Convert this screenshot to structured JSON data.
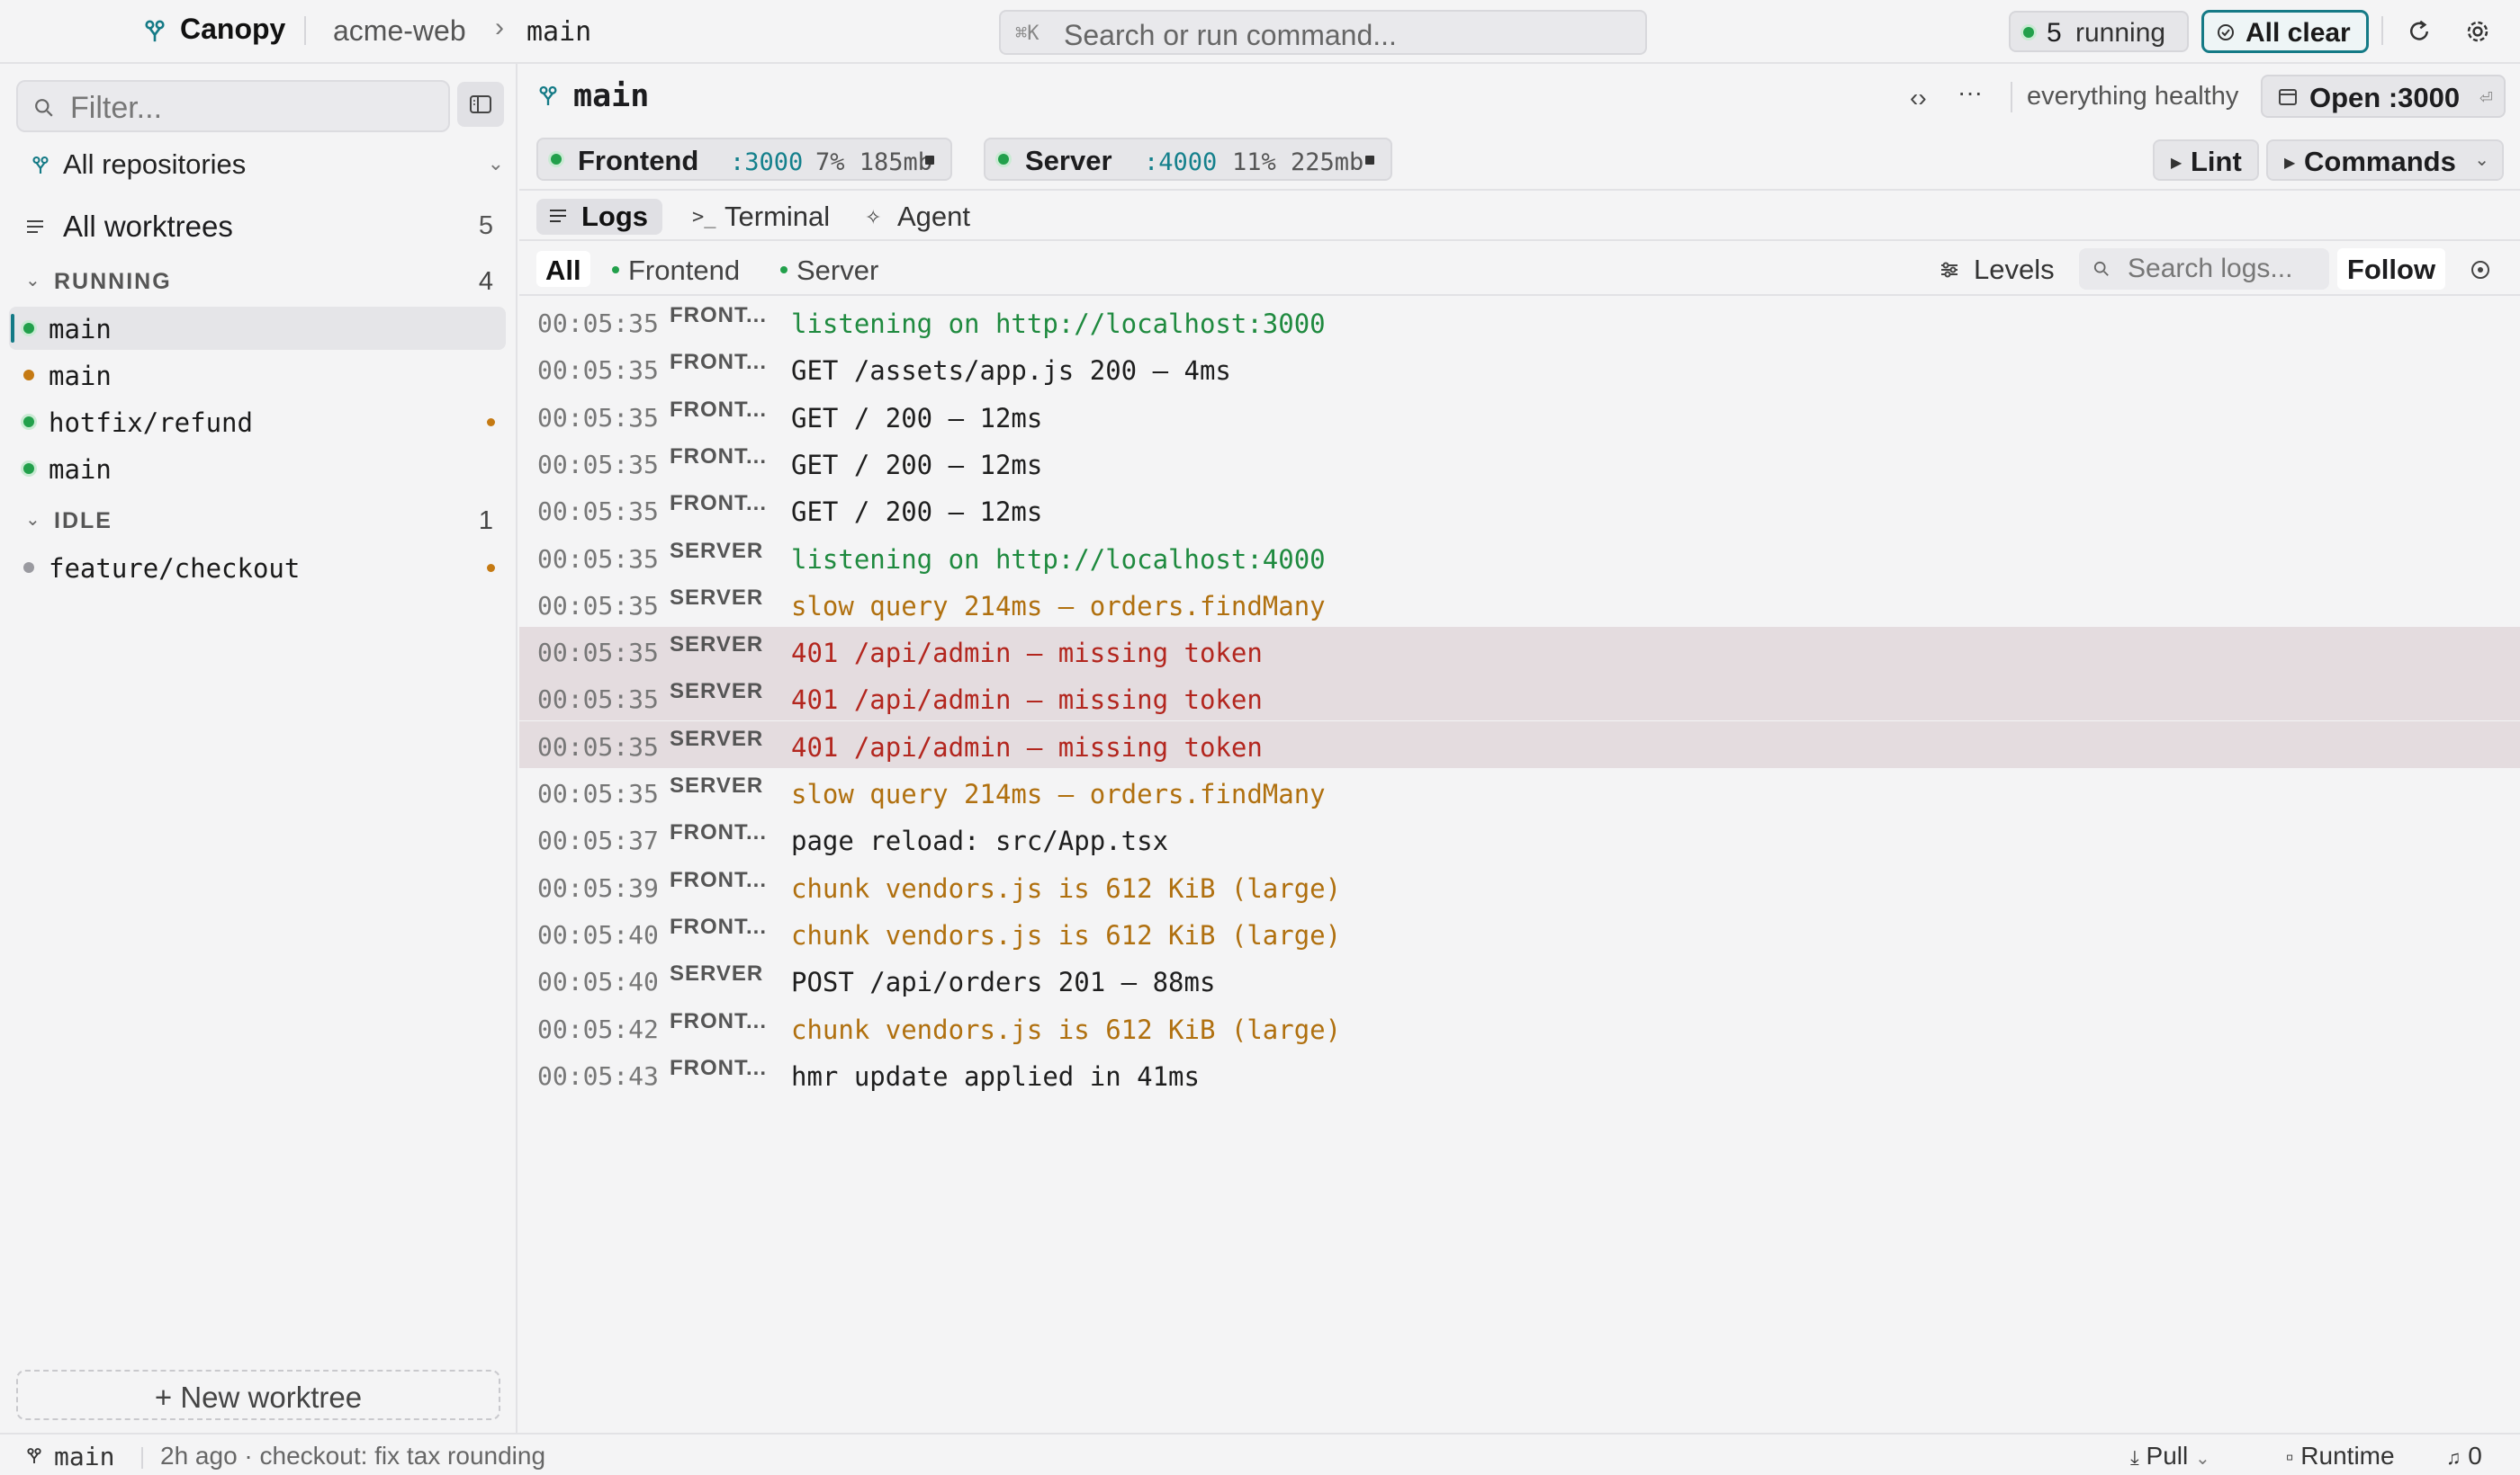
{
  "app": {
    "brand": "Canopy",
    "repo": "acme-web",
    "breadcrumb_chevron": "›",
    "branch": "main"
  },
  "command_search": {
    "shortcut": "⌘K",
    "placeholder": "Search or run command..."
  },
  "top_status": {
    "running_count": "5",
    "running_label": "running",
    "all_clear_label": "All clear"
  },
  "sidebar": {
    "filter_placeholder": "Filter...",
    "repositories_label": "All repositories",
    "all_worktrees_label": "All worktrees",
    "all_worktrees_count": "5",
    "groups": [
      {
        "label": "RUNNING",
        "count": "4",
        "items": [
          {
            "label": "main",
            "status": "green",
            "active": true,
            "modified": false
          },
          {
            "label": "main",
            "status": "orange",
            "active": false,
            "modified": false
          },
          {
            "label": "hotfix/refund",
            "status": "green",
            "active": false,
            "modified": true
          },
          {
            "label": "main",
            "status": "green",
            "active": false,
            "modified": false
          }
        ]
      },
      {
        "label": "IDLE",
        "count": "1",
        "items": [
          {
            "label": "feature/checkout",
            "status": "gray",
            "active": false,
            "modified": true
          }
        ]
      }
    ],
    "new_worktree_label": "+ New worktree"
  },
  "main": {
    "title": "main",
    "health": "everything healthy",
    "open_label": "Open :3000",
    "open_hint": "⏎",
    "processes": [
      {
        "name": "Frontend",
        "port": ":3000",
        "stats": "7% 185mb"
      },
      {
        "name": "Server",
        "port": ":4000",
        "stats": "11% 225mb"
      }
    ],
    "lint_label": "Lint",
    "commands_label": "Commands",
    "tabs": [
      {
        "label": "Logs",
        "icon": "list-icon"
      },
      {
        "label": "Terminal",
        "icon": "terminal-icon"
      },
      {
        "label": "Agent",
        "icon": "sparkle-icon"
      }
    ],
    "log_filters": [
      "All",
      "Frontend",
      "Server"
    ],
    "levels_label": "Levels",
    "log_search_placeholder": "Search logs...",
    "follow_label": "Follow"
  },
  "logs": [
    {
      "ts": "00:05:35",
      "src": "FRONT...",
      "msg": "listening on http://localhost:3000",
      "level": "ok"
    },
    {
      "ts": "00:05:35",
      "src": "FRONT...",
      "msg": "GET /assets/app.js 200 — 4ms",
      "level": "info"
    },
    {
      "ts": "00:05:35",
      "src": "FRONT...",
      "msg": "GET / 200 — 12ms",
      "level": "info"
    },
    {
      "ts": "00:05:35",
      "src": "FRONT...",
      "msg": "GET / 200 — 12ms",
      "level": "info"
    },
    {
      "ts": "00:05:35",
      "src": "FRONT...",
      "msg": "GET / 200 — 12ms",
      "level": "info"
    },
    {
      "ts": "00:05:35",
      "src": "SERVER",
      "msg": "listening on http://localhost:4000",
      "level": "ok"
    },
    {
      "ts": "00:05:35",
      "src": "SERVER",
      "msg": "slow query 214ms — orders.findMany",
      "level": "warn"
    },
    {
      "ts": "00:05:35",
      "src": "SERVER",
      "msg": "401 /api/admin — missing token",
      "level": "error"
    },
    {
      "ts": "00:05:35",
      "src": "SERVER",
      "msg": "401 /api/admin — missing token",
      "level": "error"
    },
    {
      "ts": "00:05:35",
      "src": "SERVER",
      "msg": "401 /api/admin — missing token",
      "level": "error"
    },
    {
      "ts": "00:05:35",
      "src": "SERVER",
      "msg": "slow query 214ms — orders.findMany",
      "level": "warn"
    },
    {
      "ts": "00:05:37",
      "src": "FRONT...",
      "msg": "page reload: src/App.tsx",
      "level": "info"
    },
    {
      "ts": "00:05:39",
      "src": "FRONT...",
      "msg": "chunk vendors.js is 612 KiB (large)",
      "level": "warn"
    },
    {
      "ts": "00:05:40",
      "src": "FRONT...",
      "msg": "chunk vendors.js is 612 KiB (large)",
      "level": "warn"
    },
    {
      "ts": "00:05:40",
      "src": "SERVER",
      "msg": "POST /api/orders 201 — 88ms",
      "level": "info"
    },
    {
      "ts": "00:05:42",
      "src": "FRONT...",
      "msg": "chunk vendors.js is 612 KiB (large)",
      "level": "warn"
    },
    {
      "ts": "00:05:43",
      "src": "FRONT...",
      "msg": "hmr update applied in 41ms",
      "level": "info"
    }
  ],
  "statusbar": {
    "branch": "main",
    "commit": "2h ago · checkout: fix tax rounding",
    "pull_label": "Pull",
    "runtime_label": "Runtime",
    "notifications": "0"
  },
  "colors": {
    "accent": "#147a86",
    "ok": "#22a04b",
    "warn": "#c57a13",
    "error": "#b3261e"
  }
}
